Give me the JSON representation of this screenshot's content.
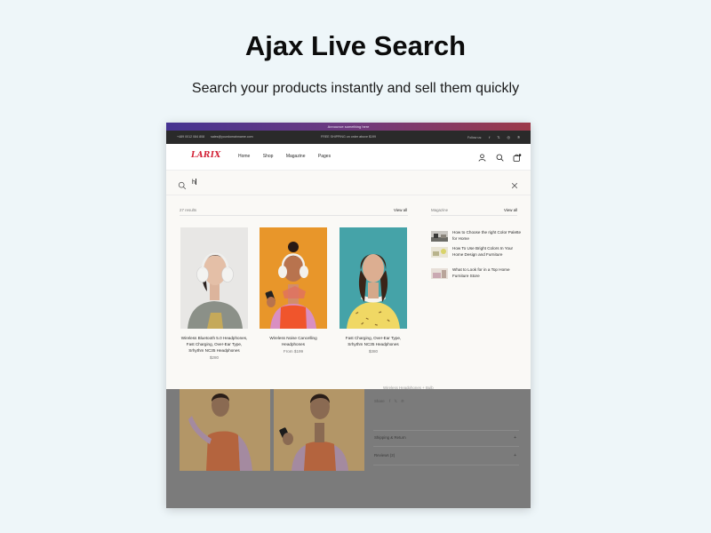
{
  "page": {
    "title": "Ajax Live Search",
    "subtitle": "Search your products instantly and sell them quickly"
  },
  "store": {
    "announcement": "Announce something here",
    "topbar": {
      "phone": "+489 0012 084 808",
      "email": "sales@yourdomainname.com",
      "shipping_notice": "FREE SHIPPING on order above $199",
      "follow_label": "Follow us:",
      "social_icons": [
        "facebook-icon",
        "twitter-icon",
        "instagram-icon",
        "pinterest-icon"
      ]
    },
    "logo": "LARIX",
    "nav": [
      "Home",
      "Shop",
      "Magazine",
      "Pages"
    ],
    "nav_icons": [
      "user-icon",
      "search-icon",
      "cart-icon"
    ],
    "colors": {
      "logo": "#d32438",
      "announce_start": "#453391",
      "announce_end": "#9c3a4a",
      "topbar": "#2a2a2a",
      "page_bg": "#eef6f9"
    }
  },
  "search": {
    "query": "h",
    "results_count": "27 results",
    "products_view_all": "View all",
    "magazine_label": "Magazine",
    "magazine_view_all": "View all",
    "products": [
      {
        "name": "Wireless Bluetooth 5.0 Headphones, Fast Charging, Over-Ear Type, Srhythm NC35 Headphones",
        "price": "$280"
      },
      {
        "name": "Wireless Noise Cancelling Headphones",
        "price": "From $199"
      },
      {
        "name": "Fast Charging, Over-Ear Type, Srhythm NC35 Headphones",
        "price": "$380"
      }
    ],
    "magazine": [
      {
        "title": "How to Choose the right Color Palette for Home"
      },
      {
        "title": "How To Use Bright Colors In Your Home Design and Furniture"
      },
      {
        "title": "What to Look for in a Top Home Furniture Store"
      }
    ]
  },
  "background_page": {
    "share_label": "Share",
    "share_icons": [
      "facebook-icon",
      "twitter-icon",
      "pinterest-icon"
    ],
    "tagline_fragment": "Wireless Headphones + Bulb",
    "accordions": [
      {
        "label": "Shipping & Return",
        "icon": "plus-icon"
      },
      {
        "label": "Reviews (2)",
        "icon": "plus-icon"
      }
    ]
  }
}
